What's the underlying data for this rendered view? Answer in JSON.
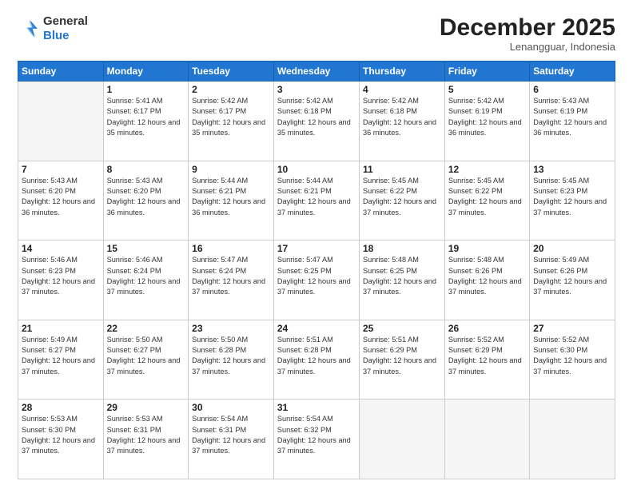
{
  "logo": {
    "general": "General",
    "blue": "Blue"
  },
  "header": {
    "month": "December 2025",
    "location": "Lenangguar, Indonesia"
  },
  "days_of_week": [
    "Sunday",
    "Monday",
    "Tuesday",
    "Wednesday",
    "Thursday",
    "Friday",
    "Saturday"
  ],
  "weeks": [
    [
      {
        "day": null
      },
      {
        "day": 1,
        "sunrise": "5:41 AM",
        "sunset": "6:17 PM",
        "daylight": "12 hours and 35 minutes."
      },
      {
        "day": 2,
        "sunrise": "5:42 AM",
        "sunset": "6:17 PM",
        "daylight": "12 hours and 35 minutes."
      },
      {
        "day": 3,
        "sunrise": "5:42 AM",
        "sunset": "6:18 PM",
        "daylight": "12 hours and 35 minutes."
      },
      {
        "day": 4,
        "sunrise": "5:42 AM",
        "sunset": "6:18 PM",
        "daylight": "12 hours and 36 minutes."
      },
      {
        "day": 5,
        "sunrise": "5:42 AM",
        "sunset": "6:19 PM",
        "daylight": "12 hours and 36 minutes."
      },
      {
        "day": 6,
        "sunrise": "5:43 AM",
        "sunset": "6:19 PM",
        "daylight": "12 hours and 36 minutes."
      }
    ],
    [
      {
        "day": 7,
        "sunrise": "5:43 AM",
        "sunset": "6:20 PM",
        "daylight": "12 hours and 36 minutes."
      },
      {
        "day": 8,
        "sunrise": "5:43 AM",
        "sunset": "6:20 PM",
        "daylight": "12 hours and 36 minutes."
      },
      {
        "day": 9,
        "sunrise": "5:44 AM",
        "sunset": "6:21 PM",
        "daylight": "12 hours and 36 minutes."
      },
      {
        "day": 10,
        "sunrise": "5:44 AM",
        "sunset": "6:21 PM",
        "daylight": "12 hours and 37 minutes."
      },
      {
        "day": 11,
        "sunrise": "5:45 AM",
        "sunset": "6:22 PM",
        "daylight": "12 hours and 37 minutes."
      },
      {
        "day": 12,
        "sunrise": "5:45 AM",
        "sunset": "6:22 PM",
        "daylight": "12 hours and 37 minutes."
      },
      {
        "day": 13,
        "sunrise": "5:45 AM",
        "sunset": "6:23 PM",
        "daylight": "12 hours and 37 minutes."
      }
    ],
    [
      {
        "day": 14,
        "sunrise": "5:46 AM",
        "sunset": "6:23 PM",
        "daylight": "12 hours and 37 minutes."
      },
      {
        "day": 15,
        "sunrise": "5:46 AM",
        "sunset": "6:24 PM",
        "daylight": "12 hours and 37 minutes."
      },
      {
        "day": 16,
        "sunrise": "5:47 AM",
        "sunset": "6:24 PM",
        "daylight": "12 hours and 37 minutes."
      },
      {
        "day": 17,
        "sunrise": "5:47 AM",
        "sunset": "6:25 PM",
        "daylight": "12 hours and 37 minutes."
      },
      {
        "day": 18,
        "sunrise": "5:48 AM",
        "sunset": "6:25 PM",
        "daylight": "12 hours and 37 minutes."
      },
      {
        "day": 19,
        "sunrise": "5:48 AM",
        "sunset": "6:26 PM",
        "daylight": "12 hours and 37 minutes."
      },
      {
        "day": 20,
        "sunrise": "5:49 AM",
        "sunset": "6:26 PM",
        "daylight": "12 hours and 37 minutes."
      }
    ],
    [
      {
        "day": 21,
        "sunrise": "5:49 AM",
        "sunset": "6:27 PM",
        "daylight": "12 hours and 37 minutes."
      },
      {
        "day": 22,
        "sunrise": "5:50 AM",
        "sunset": "6:27 PM",
        "daylight": "12 hours and 37 minutes."
      },
      {
        "day": 23,
        "sunrise": "5:50 AM",
        "sunset": "6:28 PM",
        "daylight": "12 hours and 37 minutes."
      },
      {
        "day": 24,
        "sunrise": "5:51 AM",
        "sunset": "6:28 PM",
        "daylight": "12 hours and 37 minutes."
      },
      {
        "day": 25,
        "sunrise": "5:51 AM",
        "sunset": "6:29 PM",
        "daylight": "12 hours and 37 minutes."
      },
      {
        "day": 26,
        "sunrise": "5:52 AM",
        "sunset": "6:29 PM",
        "daylight": "12 hours and 37 minutes."
      },
      {
        "day": 27,
        "sunrise": "5:52 AM",
        "sunset": "6:30 PM",
        "daylight": "12 hours and 37 minutes."
      }
    ],
    [
      {
        "day": 28,
        "sunrise": "5:53 AM",
        "sunset": "6:30 PM",
        "daylight": "12 hours and 37 minutes."
      },
      {
        "day": 29,
        "sunrise": "5:53 AM",
        "sunset": "6:31 PM",
        "daylight": "12 hours and 37 minutes."
      },
      {
        "day": 30,
        "sunrise": "5:54 AM",
        "sunset": "6:31 PM",
        "daylight": "12 hours and 37 minutes."
      },
      {
        "day": 31,
        "sunrise": "5:54 AM",
        "sunset": "6:32 PM",
        "daylight": "12 hours and 37 minutes."
      },
      {
        "day": null
      },
      {
        "day": null
      },
      {
        "day": null
      }
    ]
  ],
  "labels": {
    "sunrise": "Sunrise:",
    "sunset": "Sunset:",
    "daylight": "Daylight:"
  }
}
